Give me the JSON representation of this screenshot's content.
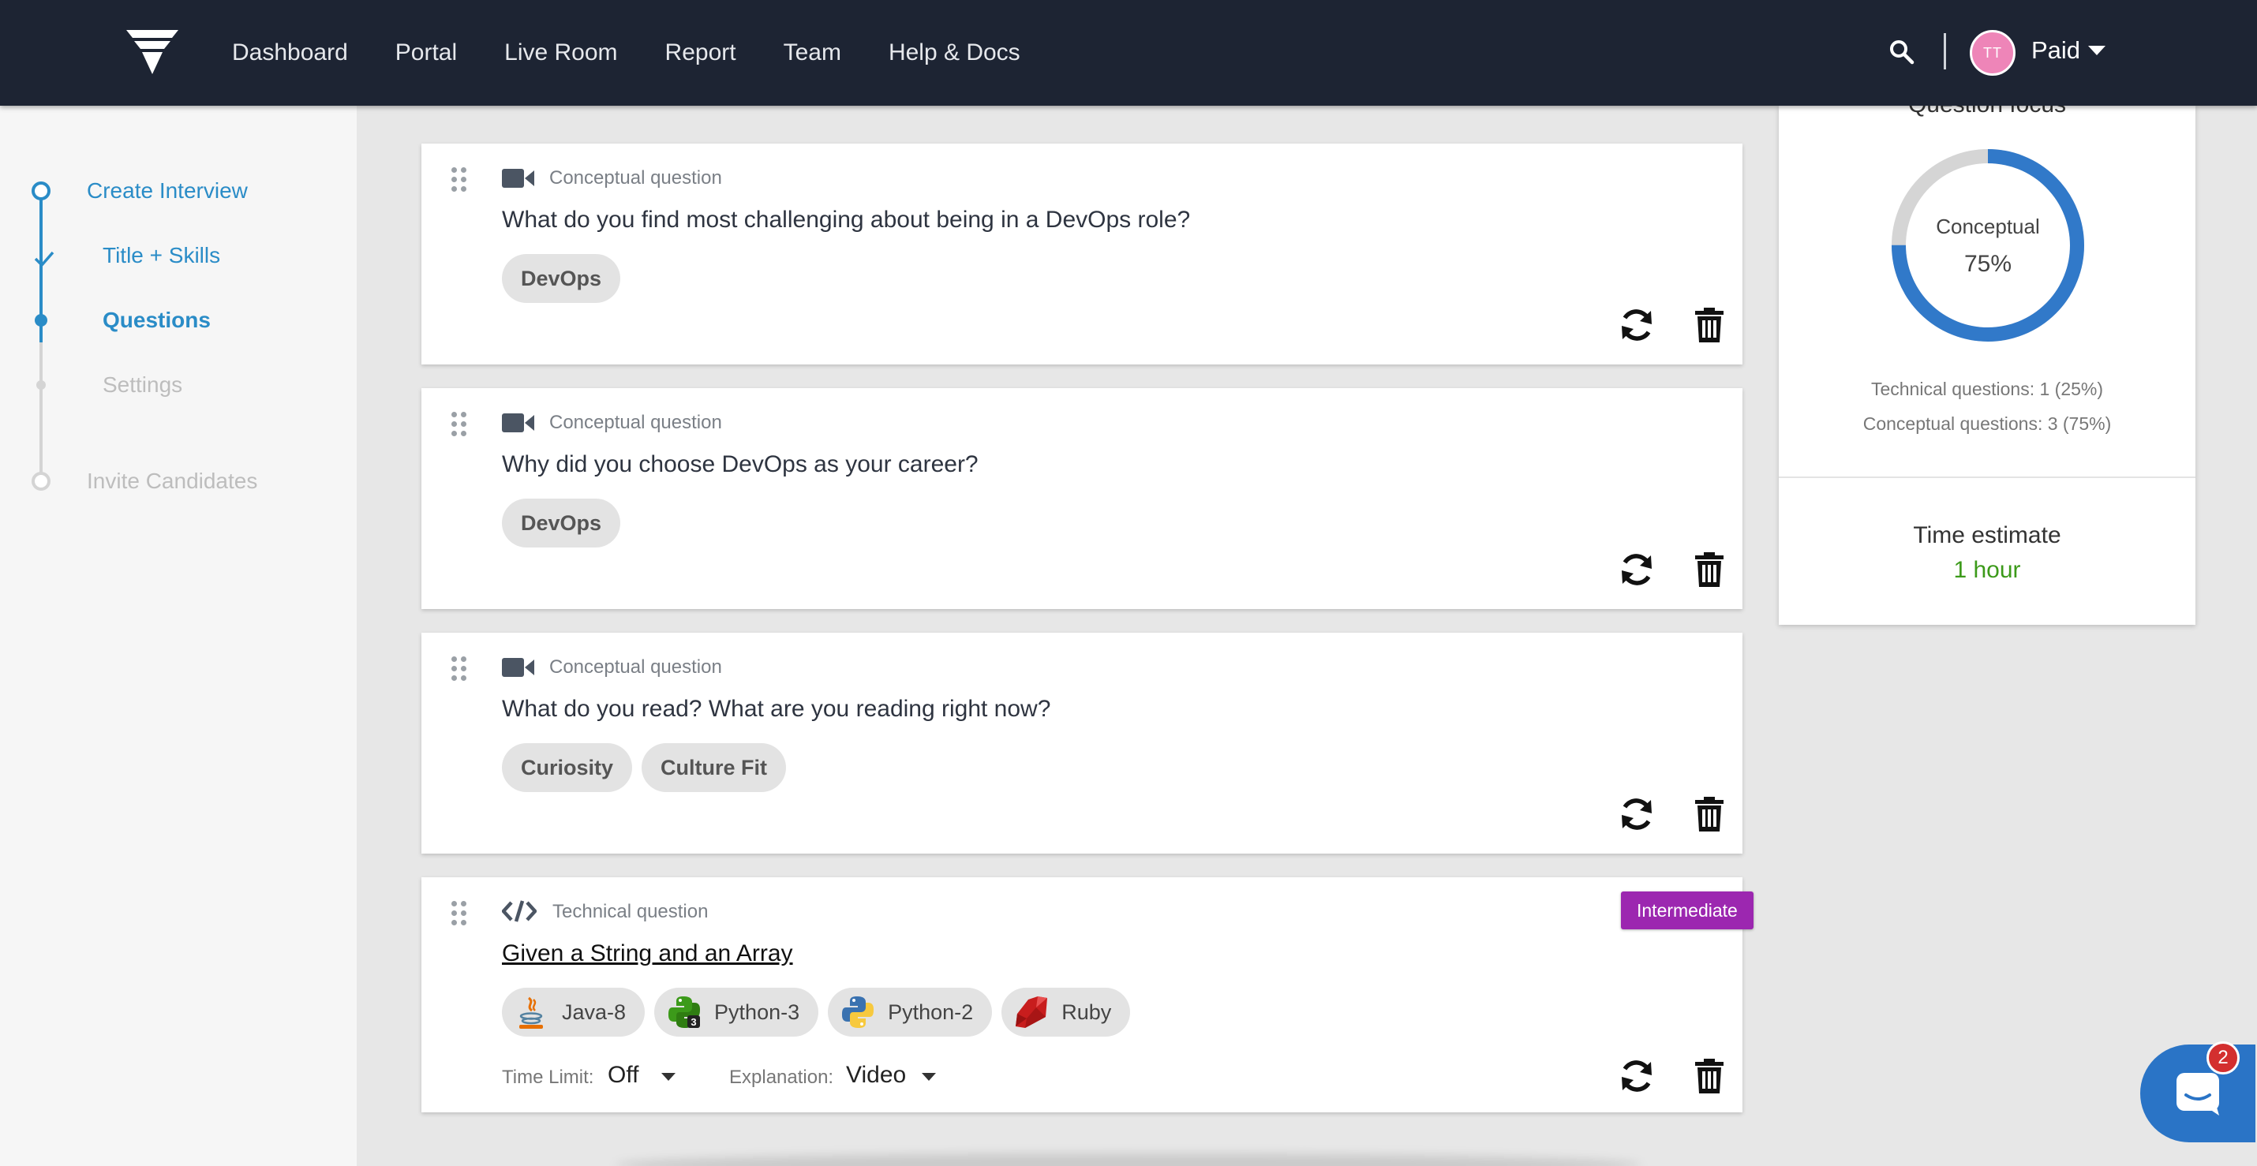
{
  "nav": {
    "links": [
      "Dashboard",
      "Portal",
      "Live Room",
      "Report",
      "Team",
      "Help & Docs"
    ],
    "avatar_initials": "TT",
    "plan_label": "Paid"
  },
  "sidebar": {
    "steps": {
      "create": "Create Interview",
      "title_skills": "Title + Skills",
      "questions": "Questions",
      "settings": "Settings",
      "invite": "Invite Candidates"
    }
  },
  "questions": [
    {
      "type": "Conceptual question",
      "title": "What do you find most challenging about being in a DevOps role?",
      "tags": [
        "DevOps"
      ]
    },
    {
      "type": "Conceptual question",
      "title": "Why did you choose DevOps as your career?",
      "tags": [
        "DevOps"
      ]
    },
    {
      "type": "Conceptual question",
      "title": "What do you read? What are you reading right now?",
      "tags": [
        "Curiosity",
        "Culture Fit"
      ]
    },
    {
      "type": "Technical question",
      "title": "Given a String and an Array",
      "level": "Intermediate",
      "languages": [
        "Java-8",
        "Python-3",
        "Python-2",
        "Ruby"
      ],
      "time_limit_label": "Time Limit:",
      "time_limit_value": "Off",
      "explanation_label": "Explanation:",
      "explanation_value": "Video"
    }
  ],
  "summary": {
    "heading": "Question focus",
    "donut_label": "Conceptual",
    "donut_percent": "75%",
    "conceptual_fraction": 0.75,
    "technical_line": "Technical questions: 1 (25%)",
    "conceptual_line": "Conceptual questions: 3 (75%)",
    "time_title": "Time estimate",
    "time_value": "1 hour"
  },
  "chat": {
    "unread_count": "2"
  },
  "colors": {
    "nav_bg": "#1d2433",
    "accent": "#2a8cc7",
    "donut_fill": "#3179c9",
    "level_badge": "#9c27b0",
    "time_value": "#3c9a1a"
  }
}
